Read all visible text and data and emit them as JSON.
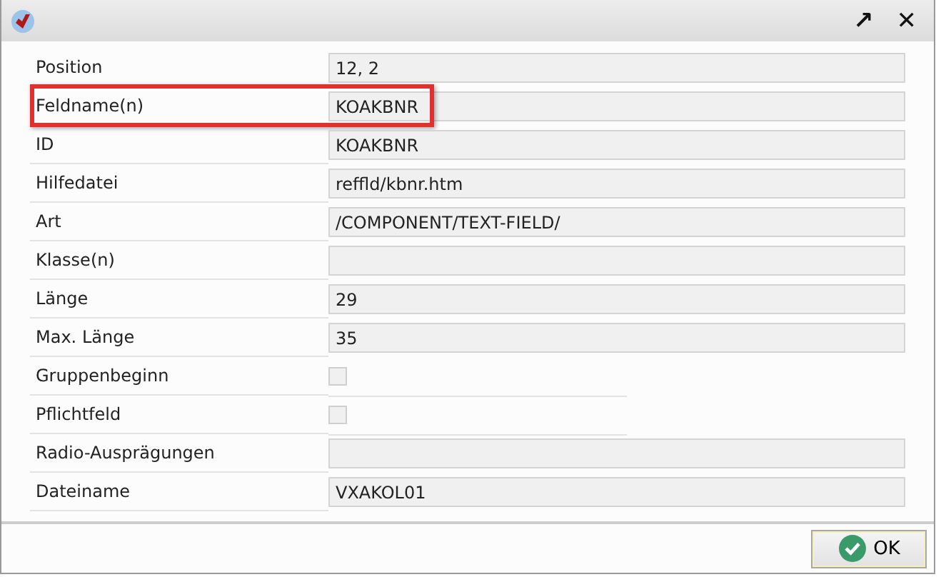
{
  "window": {
    "title_buttons": [
      "↗",
      "✕"
    ]
  },
  "rows": [
    {
      "label": "Position",
      "kind": "text",
      "value": "12, 2",
      "highlighted": false
    },
    {
      "label": "Feldname(n)",
      "kind": "text",
      "value": "KOAKBNR",
      "highlighted": true
    },
    {
      "label": "ID",
      "kind": "text",
      "value": "KOAKBNR",
      "highlighted": false
    },
    {
      "label": "Hilfedatei",
      "kind": "text",
      "value": "reffld/kbnr.htm",
      "highlighted": false
    },
    {
      "label": "Art",
      "kind": "text",
      "value": "/COMPONENT/TEXT-FIELD/",
      "highlighted": false
    },
    {
      "label": "Klasse(n)",
      "kind": "text",
      "highlighted": false
    },
    {
      "label": "Länge",
      "kind": "text",
      "value": "29",
      "highlighted": false
    },
    {
      "label": "Max. Länge",
      "kind": "text",
      "value": "35",
      "highlighted": false
    },
    {
      "label": "Gruppenbeginn",
      "kind": "checkbox",
      "checked": false,
      "highlighted": false
    },
    {
      "label": "Pflichtfeld",
      "kind": "checkbox",
      "checked": false,
      "highlighted": false
    },
    {
      "label": "Radio-Ausprägungen",
      "kind": "text",
      "highlighted": false
    },
    {
      "label": "Dateiname",
      "kind": "text",
      "value": "VXAKOL01",
      "highlighted": false
    }
  ],
  "buttons": [
    "OK"
  ]
}
